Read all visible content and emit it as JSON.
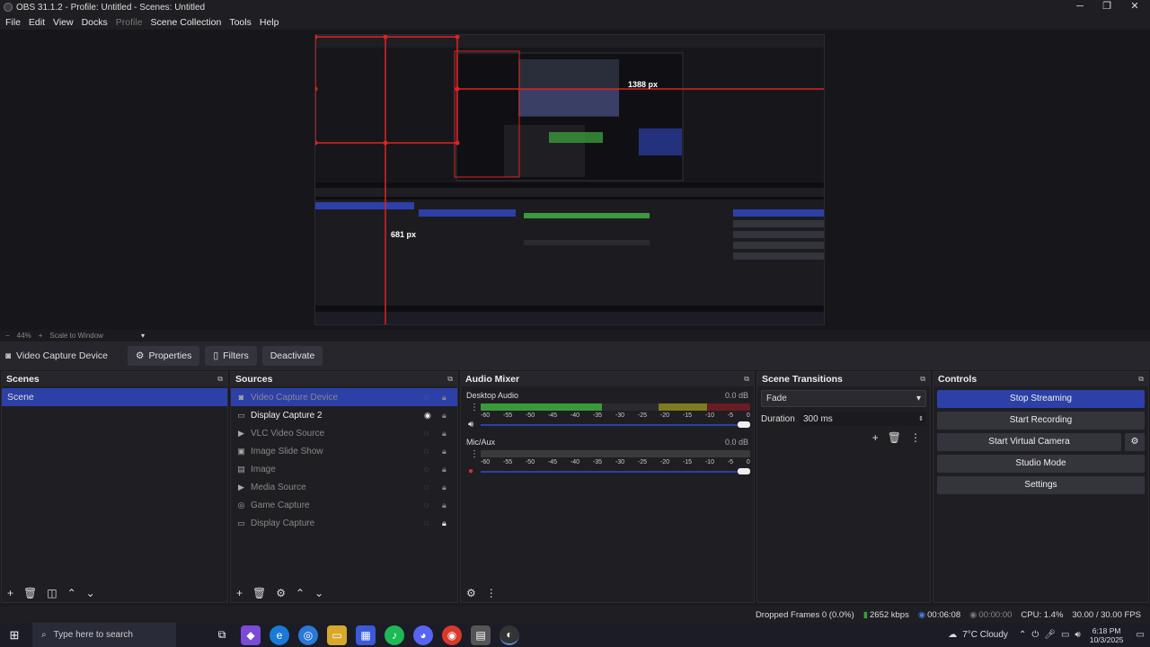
{
  "window": {
    "title": "OBS 31.1.2 - Profile: Untitled - Scenes: Untitled",
    "min": "─",
    "max": "❐",
    "close": "✕"
  },
  "menu": [
    "File",
    "Edit",
    "View",
    "Docks",
    "Profile",
    "Scene Collection",
    "Tools",
    "Help"
  ],
  "preview": {
    "label_width": "1388 px",
    "label_height": "681 px"
  },
  "zoom": {
    "minus": "−",
    "level": "44%",
    "plus": "+",
    "mode": "Scale to Window"
  },
  "source_bar": {
    "current_source": "Video Capture Device",
    "properties": "Properties",
    "filters": "Filters",
    "deactivate": "Deactivate"
  },
  "scenes": {
    "title": "Scenes",
    "items": [
      "Scene"
    ]
  },
  "sources": {
    "title": "Sources",
    "items": [
      {
        "name": "Video Capture Device",
        "icon": "camera-icon"
      },
      {
        "name": "Display Capture 2",
        "icon": "monitor-icon"
      },
      {
        "name": "VLC Video Source",
        "icon": "play-icon"
      },
      {
        "name": "Image Slide Show",
        "icon": "slideshow-icon"
      },
      {
        "name": "Image",
        "icon": "image-icon"
      },
      {
        "name": "Media Source",
        "icon": "play-icon"
      },
      {
        "name": "Game Capture",
        "icon": "gamepad-icon"
      },
      {
        "name": "Display Capture",
        "icon": "monitor-icon"
      }
    ]
  },
  "audio": {
    "title": "Audio Mixer",
    "channels": [
      {
        "name": "Desktop Audio",
        "db": "0.0 dB",
        "level": 0.45,
        "volume": 1.0
      },
      {
        "name": "Mic/Aux",
        "db": "0.0 dB",
        "level": 0.0,
        "volume": 1.0
      }
    ],
    "ticks": [
      "-60",
      "-55",
      "-50",
      "-45",
      "-40",
      "-35",
      "-30",
      "-25",
      "-20",
      "-15",
      "-10",
      "-5",
      "0"
    ]
  },
  "transitions": {
    "title": "Scene Transitions",
    "selected": "Fade",
    "duration_label": "Duration",
    "duration_value": "300 ms"
  },
  "controls": {
    "title": "Controls",
    "buttons": [
      "Stop Streaming",
      "Start Recording",
      "Start Virtual Camera",
      "Studio Mode",
      "Settings"
    ]
  },
  "status": {
    "dropped": "Dropped Frames 0 (0.0%)",
    "bitrate": "2652 kbps",
    "stream_time": "00:06:08",
    "rec_time": "00:00:00",
    "cpu": "CPU: 1.4%",
    "fps": "30.00 / 30.00 FPS"
  },
  "taskbar": {
    "search_placeholder": "Type here to search",
    "weather": "7°C  Cloudy",
    "time": "6:18 PM",
    "date": "10/3/2025"
  },
  "colors": {
    "accent": "#2d40a8",
    "meter_green": "#3a9a3a",
    "meter_yellow": "#a89a2a",
    "meter_red": "#b02a2a"
  }
}
